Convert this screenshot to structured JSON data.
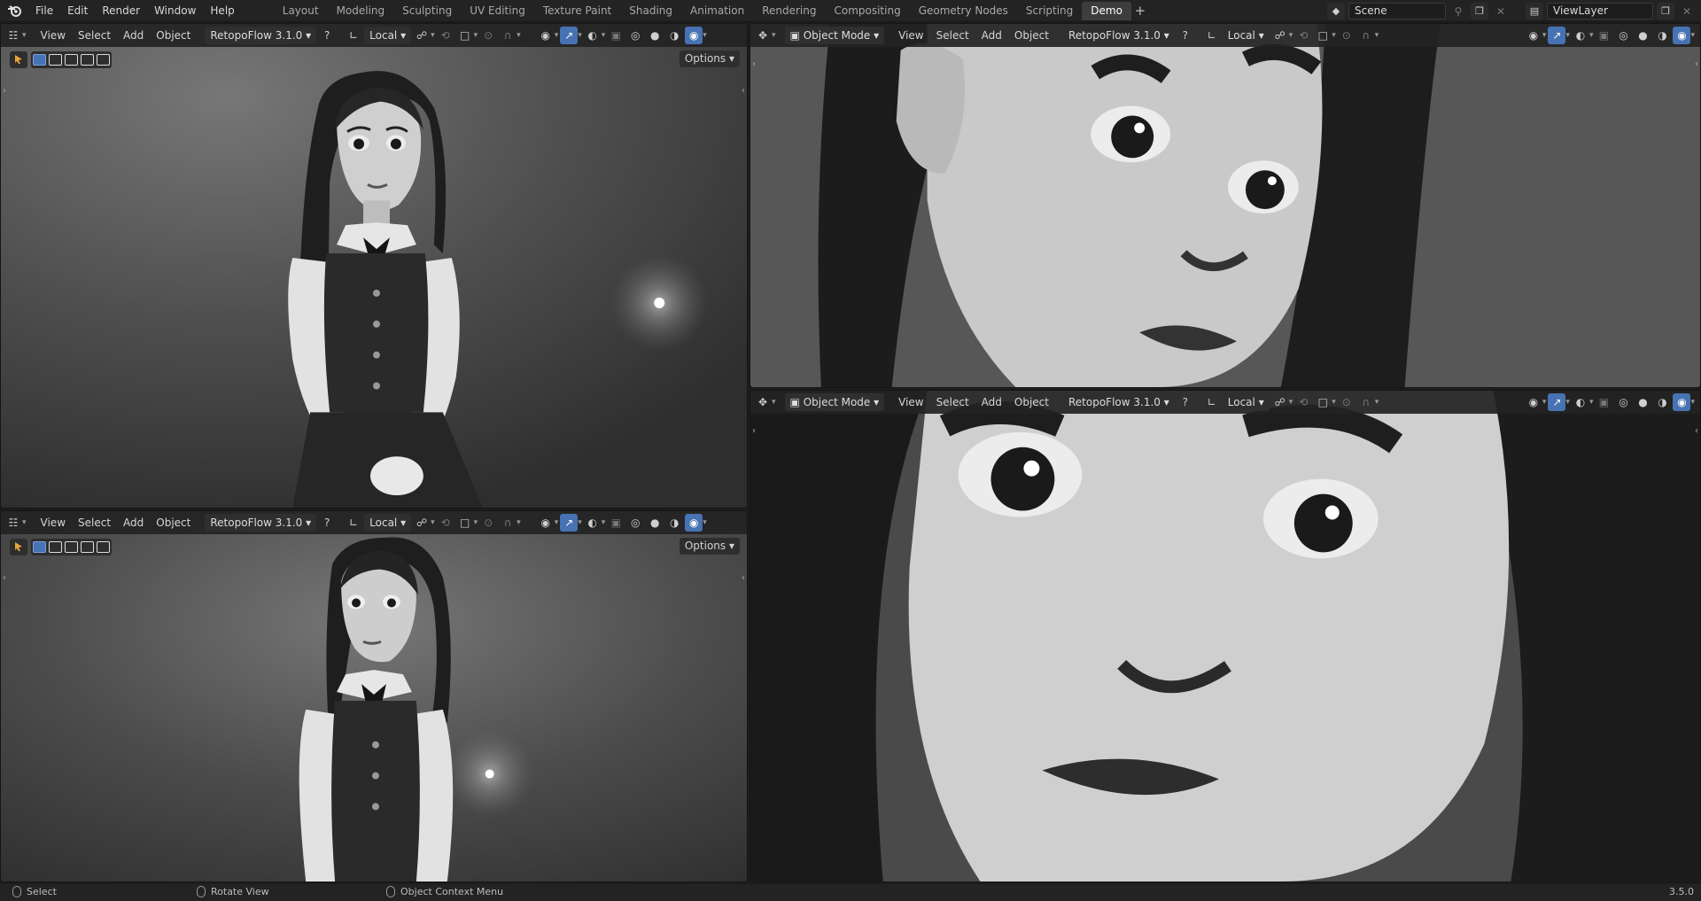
{
  "menu": [
    "File",
    "Edit",
    "Render",
    "Window",
    "Help"
  ],
  "workspaces": [
    "Layout",
    "Modeling",
    "Sculpting",
    "UV Editing",
    "Texture Paint",
    "Shading",
    "Animation",
    "Rendering",
    "Compositing",
    "Geometry Nodes",
    "Scripting",
    "Demo"
  ],
  "active_workspace": "Demo",
  "scene_name": "Scene",
  "view_layer": "ViewLayer",
  "viewport_header": {
    "mode": "Object Mode",
    "view": "View",
    "select": "Select",
    "add": "Add",
    "object": "Object",
    "addon": "RetopoFlow 3.1.0",
    "orientation": "Local",
    "options": "Options"
  },
  "status": {
    "select": "Select",
    "rotate": "Rotate View",
    "context_menu": "Object Context Menu",
    "version": "3.5.0"
  },
  "colors": {
    "accent": "#4772b3",
    "header_bg": "#232323",
    "active_tab_bg": "#3d3d3d"
  },
  "icons": [
    "blender-logo",
    "scene-icon",
    "pin-icon",
    "new-icon",
    "close-icon",
    "view-layer-icon",
    "editor-type-icon",
    "cursor-icon",
    "select-box-icon",
    "help-icon",
    "transform-orientation-icon",
    "pivot-icon",
    "snap-icon",
    "proportional-icon",
    "visibility-icon",
    "gizmo-icon",
    "overlay-icon",
    "xray-icon",
    "wireframe-icon",
    "solid-icon",
    "material-icon",
    "rendered-icon",
    "mouse-left-icon",
    "mouse-middle-icon",
    "mouse-right-icon"
  ]
}
